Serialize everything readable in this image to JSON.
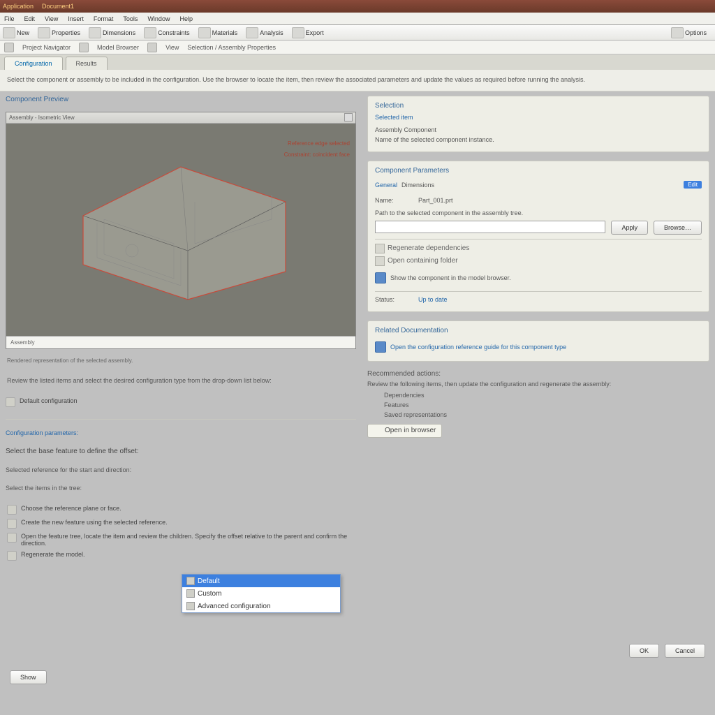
{
  "titlebar": {
    "app": "Application",
    "doc": "Document1"
  },
  "menubar": {
    "items": [
      "File",
      "Edit",
      "View",
      "Insert",
      "Format",
      "Tools",
      "Window",
      "Help"
    ]
  },
  "toolbar": {
    "groups": [
      {
        "label": "New"
      },
      {
        "label": "Properties"
      },
      {
        "label": "Dimensions"
      },
      {
        "label": "Constraints"
      },
      {
        "label": "Materials"
      },
      {
        "label": "Analysis"
      },
      {
        "label": "Export"
      }
    ],
    "right": {
      "label": "Options"
    }
  },
  "subbar": {
    "items": [
      "Project Navigator",
      "Model Browser",
      "View",
      "Selection / Assembly Properties"
    ]
  },
  "tabs": {
    "items": [
      {
        "label": "Configuration",
        "active": true
      },
      {
        "label": "Results",
        "active": false
      }
    ]
  },
  "description": "Select the component or assembly to be included in the configuration. Use the browser to locate the item, then review the associated parameters and update the values as required before running the analysis.",
  "viewport": {
    "section_title": "Component Preview",
    "title": "Assembly - Isometric View",
    "callout1": "Reference edge selected",
    "callout2": "Constraint: coincident face",
    "status": "Assembly",
    "caption": "Rendered representation of the selected assembly."
  },
  "left_lower": {
    "para": "Review the listed items and select the desired configuration type from the drop-down list below:",
    "item": "Default configuration",
    "sep_title": "Configuration parameters:",
    "heading": "Select the base feature to define the offset:",
    "sub": "Selected reference for the start and direction:",
    "choose": "Select the items in the tree:",
    "steps": [
      {
        "icon": "wrench-icon",
        "text": "Choose the reference plane or face."
      },
      {
        "icon": "cube-icon",
        "text": "Create the new feature using the selected reference."
      },
      {
        "icon": "layers-icon",
        "text": "Open the feature tree, locate the item and review the children. Specify the offset relative to the parent and confirm the direction."
      },
      {
        "icon": "gear-icon",
        "text": "Regenerate the model."
      }
    ]
  },
  "dropdown": {
    "items": [
      {
        "label": "Default",
        "selected": true
      },
      {
        "label": "Custom",
        "selected": false
      },
      {
        "label": "Advanced configuration",
        "selected": false
      }
    ]
  },
  "right": {
    "panel1": {
      "title": "Selection",
      "link": "Selected item",
      "sub": "Assembly Component",
      "desc": "Name of the selected component instance."
    },
    "panel2": {
      "title": "Component Parameters",
      "tab1": "General",
      "tab2": "Dimensions",
      "badge": "Edit",
      "row_label": "Name:",
      "row_value": "Part_001.prt",
      "desc": "Path to the selected component in the assembly tree.",
      "btn1": "Apply",
      "btn2": "Browse…",
      "link1": "Regenerate dependencies",
      "icon_label": "regen-icon",
      "link2": "Open containing folder",
      "note": "Show the component in the model browser.",
      "footer_label": "Status:",
      "footer_value": "Up to date"
    },
    "panel3": {
      "title": "Related Documentation",
      "link": "Open the configuration reference guide for this component type"
    },
    "lower": {
      "title": "Recommended actions:",
      "para": "Review the following items, then update the configuration and regenerate the assembly:",
      "bullets": [
        "Dependencies",
        "Features",
        "Saved representations"
      ],
      "chip": "Open in browser"
    }
  },
  "footer": {
    "ok": "OK",
    "cancel": "Cancel",
    "show": "Show"
  }
}
